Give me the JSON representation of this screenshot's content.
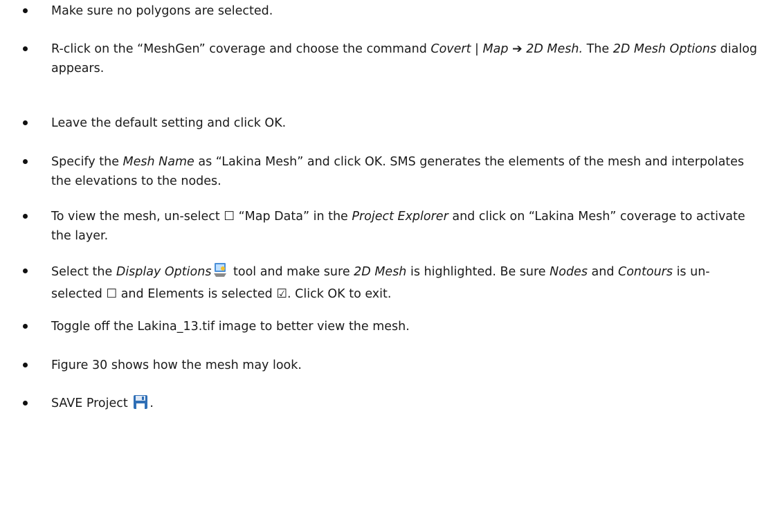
{
  "steps": [
    {
      "parts": [
        {
          "t": "Make sure no polygons are selected."
        }
      ]
    },
    {
      "parts": [
        {
          "t": "R-click on the “MeshGen” coverage and choose the command "
        },
        {
          "t": "Covert | Map ",
          "i": true
        },
        {
          "t": "➔",
          "i": true
        },
        {
          "t": " 2D Mesh.",
          "i": true
        },
        {
          "t": " The "
        },
        {
          "t": "2D Mesh Options",
          "i": true
        },
        {
          "t": " dialog appears."
        }
      ]
    },
    {
      "parts": [
        {
          "t": "Leave the default setting and click OK."
        }
      ]
    },
    {
      "parts": [
        {
          "t": "Specify the "
        },
        {
          "t": "Mesh Name",
          "i": true
        },
        {
          "t": " as “Lakina Mesh” and click OK. SMS generates the elements of the mesh and interpolates the elevations to the nodes."
        }
      ]
    },
    {
      "parts": [
        {
          "t": "To view the mesh, un-select "
        },
        {
          "t": "☐",
          "box": true
        },
        {
          "t": " “Map Data” in the "
        },
        {
          "t": "Project Explorer",
          "i": true
        },
        {
          "t": " and click on “Lakina Mesh” coverage to activate the layer."
        }
      ]
    },
    {
      "parts": [
        {
          "t": "Select the "
        },
        {
          "t": "Display Options",
          "i": true
        },
        {
          "icon": "display-options-icon"
        },
        {
          "t": " tool and make sure "
        },
        {
          "t": "2D Mesh",
          "i": true
        },
        {
          "t": " is highlighted. Be sure "
        },
        {
          "t": "Nodes",
          "i": true
        },
        {
          "t": " and "
        },
        {
          "t": "Contours",
          "i": true
        },
        {
          "t": " is un-selected "
        },
        {
          "t": "☐",
          "box": true
        },
        {
          "t": " and Elements is selected "
        },
        {
          "t": "☑",
          "box": true
        },
        {
          "t": ". Click OK to exit."
        }
      ]
    },
    {
      "parts": [
        {
          "t": "Toggle off the Lakina_13.tif image to better view the mesh."
        }
      ]
    },
    {
      "parts": [
        {
          "t": "Figure 30 shows how the mesh may look."
        }
      ]
    },
    {
      "parts": [
        {
          "t": "SAVE Project "
        },
        {
          "icon": "save-icon"
        },
        {
          "t": "."
        }
      ]
    }
  ],
  "colors": {
    "text": "#1a1a1a",
    "save_icon": "#2f6fb6",
    "display_icon": "#4a8fd8"
  }
}
